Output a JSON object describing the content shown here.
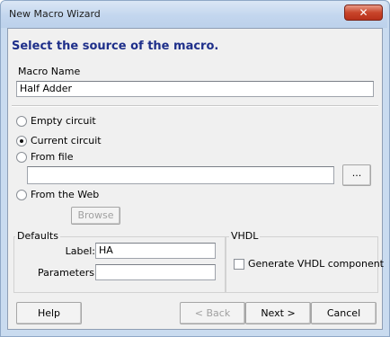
{
  "window": {
    "title": "New Macro Wizard",
    "close_glyph": "✕"
  },
  "heading": "Select the source of the macro.",
  "macro_name": {
    "label": "Macro Name",
    "value": "Half Adder"
  },
  "source": {
    "options": [
      {
        "label": "Empty circuit",
        "selected": false
      },
      {
        "label": "Current circuit",
        "selected": true
      },
      {
        "label": "From file",
        "selected": false
      },
      {
        "label": "From the Web",
        "selected": false
      }
    ],
    "file_path": "",
    "browse_file_label": "...",
    "browse_label": "Browse"
  },
  "defaults": {
    "title": "Defaults",
    "label_caption": "Label:",
    "label_value": "HA",
    "parameters_caption": "Parameters:",
    "parameters_value": ""
  },
  "vhdl": {
    "title": "VHDL",
    "generate_label": "Generate VHDL component",
    "generate_checked": false
  },
  "buttons": {
    "help": "Help",
    "back": "< Back",
    "next": "Next >",
    "cancel": "Cancel"
  }
}
